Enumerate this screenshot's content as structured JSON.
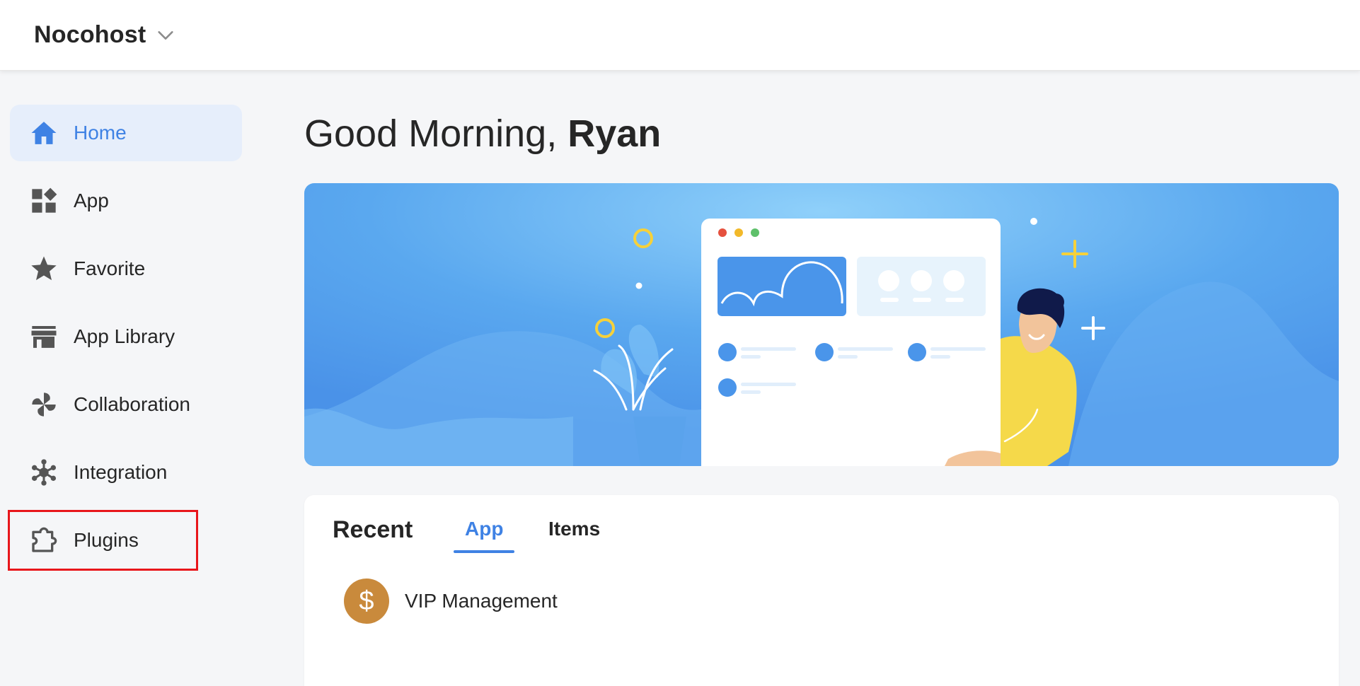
{
  "header": {
    "workspace_name": "Nocohost",
    "dropdown_icon": "chevron-down-icon"
  },
  "sidebar": {
    "items": [
      {
        "label": "Home",
        "icon": "home-icon",
        "active": true
      },
      {
        "label": "App",
        "icon": "apps-grid-icon"
      },
      {
        "label": "Favorite",
        "icon": "star-icon"
      },
      {
        "label": "App Library",
        "icon": "store-icon"
      },
      {
        "label": "Collaboration",
        "icon": "pinwheel-icon"
      },
      {
        "label": "Integration",
        "icon": "network-hub-icon"
      },
      {
        "label": "Plugins",
        "icon": "puzzle-icon",
        "highlighted": true
      }
    ]
  },
  "main": {
    "greeting_prefix": "Good Morning, ",
    "user_name": "Ryan",
    "recent": {
      "title": "Recent",
      "tabs": [
        {
          "label": "App",
          "active": true
        },
        {
          "label": "Items"
        }
      ],
      "apps": [
        {
          "name": "VIP Management",
          "icon_glyph": "$"
        }
      ]
    }
  },
  "colors": {
    "accent": "#3f82e4",
    "active_bg": "#e6eefb",
    "highlight_box": "#e8161b",
    "app_badge": "#c98a3c"
  }
}
